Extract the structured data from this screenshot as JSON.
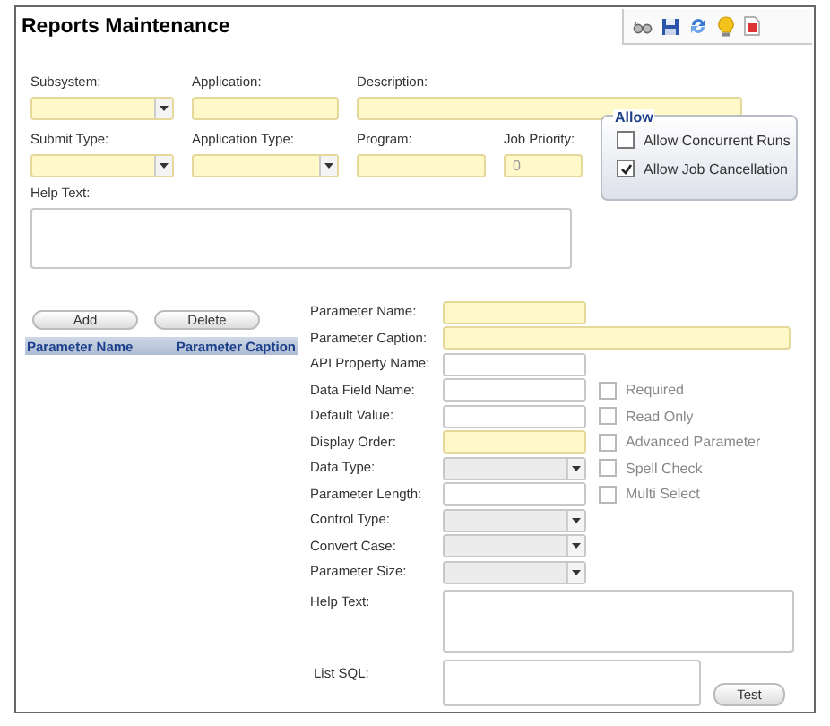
{
  "window": {
    "title": "Reports Maintenance"
  },
  "top_fields": [
    {
      "label": "Subsystem:",
      "kind": "select",
      "required": true
    },
    {
      "label": "Application:",
      "kind": "text",
      "required": true
    },
    {
      "label": "Description:",
      "kind": "wide",
      "required": true
    },
    {
      "label": "Submit Type:",
      "kind": "select",
      "required": true
    },
    {
      "label": "Application Type:",
      "kind": "select",
      "required": true
    },
    {
      "label": "Program:",
      "kind": "text",
      "required": true
    },
    {
      "label": "Job Priority:",
      "kind": "text",
      "required": true,
      "value": "0"
    }
  ],
  "allow": {
    "title": "Allow",
    "options": [
      {
        "label": "Allow Concurrent Runs",
        "checked": false
      },
      {
        "label": "Allow Job Cancellation",
        "checked": true
      }
    ]
  },
  "help_text": {
    "label": "Help Text:"
  },
  "parameter_buttons": [
    "Add",
    "Delete"
  ],
  "parameter_list": {
    "columns": [
      "Parameter Name",
      "Parameter Caption"
    ]
  },
  "parameter_form": [
    {
      "label": "Parameter Name:",
      "kind": "text",
      "required": true
    },
    {
      "label": "Parameter Caption:",
      "kind": "wide",
      "required": true
    },
    {
      "label": "API Property Name:",
      "kind": "text",
      "required": false
    },
    {
      "label": "Data Field Name:",
      "kind": "text",
      "required": false
    },
    {
      "label": "Default Value:",
      "kind": "text",
      "required": false
    },
    {
      "label": "Display Order:",
      "kind": "text",
      "required": true
    },
    {
      "label": "Data Type:",
      "kind": "select",
      "required": false
    },
    {
      "label": "Parameter Length:",
      "kind": "text",
      "required": false
    },
    {
      "label": "Control Type:",
      "kind": "select",
      "required": false
    },
    {
      "label": "Convert Case:",
      "kind": "select",
      "required": false
    },
    {
      "label": "Parameter Size:",
      "kind": "select",
      "required": false
    },
    {
      "label": "Help Text:",
      "kind": "textarea",
      "required": false
    },
    {
      "label": "List SQL:",
      "kind": "sql",
      "required": false
    }
  ],
  "parameter_options": [
    {
      "label": "Required",
      "checked": false,
      "disabled": true
    },
    {
      "label": "Read Only",
      "checked": false,
      "disabled": true
    },
    {
      "label": "Advanced Parameter",
      "checked": false,
      "disabled": true
    },
    {
      "label": "Spell Check",
      "checked": false,
      "disabled": true
    },
    {
      "label": "Multi Select",
      "checked": false,
      "disabled": true
    }
  ],
  "test_button": "Test"
}
